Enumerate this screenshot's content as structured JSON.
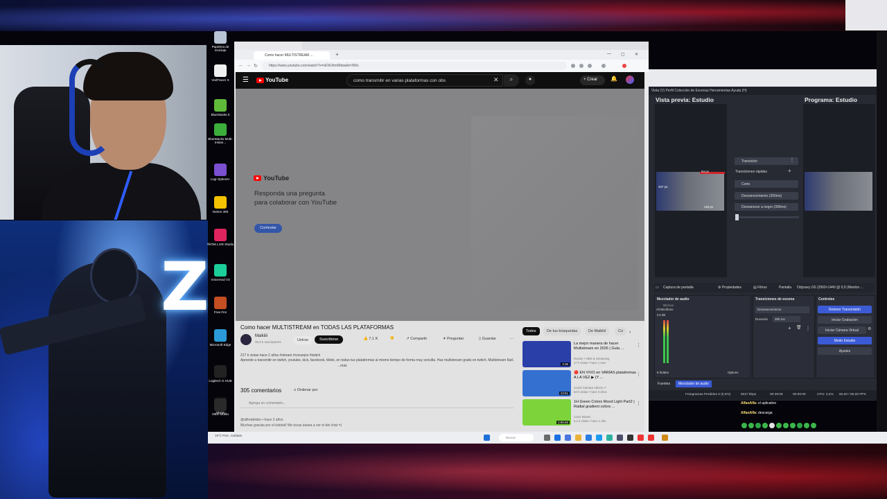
{
  "colors": {
    "youtube_red": "#ff0000",
    "obs_bg": "#272a33",
    "obs_accent": "#3b5bd6",
    "subscribe_bg": "#0f0f0f"
  },
  "desktop_icons": [
    {
      "label": "Papelera de reciclaje",
      "icon": "recycle-bin-icon",
      "color": "#b8c4d4"
    },
    {
      "label": "VodTracer S",
      "icon": "file-icon",
      "color": "#f0f0f0"
    },
    {
      "label": "BlueStacks 5",
      "icon": "bluestacks-icon",
      "color": "#5fba3a"
    },
    {
      "label": "BlueStacks Multi-Instan...",
      "icon": "bluestacks-multi-icon",
      "color": "#3cae3c"
    },
    {
      "label": "Logi Options+",
      "icon": "logi-icon",
      "color": "#7a4fd0"
    },
    {
      "label": "Norton 360",
      "icon": "norton-icon",
      "color": "#f3c200"
    },
    {
      "label": "TikTok LIVE Studio",
      "icon": "tiktok-live-icon",
      "color": "#e0245e"
    },
    {
      "label": "Voicemod V3",
      "icon": "voicemod-icon",
      "color": "#1bcf9a"
    },
    {
      "label": "Free Fire",
      "icon": "freefire-icon",
      "color": "#c24e22"
    },
    {
      "label": "Microsoft Edge",
      "icon": "edge-icon",
      "color": "#2a9bd8"
    },
    {
      "label": "Logitech G HUB",
      "icon": "ghub-icon",
      "color": "#222222"
    },
    {
      "label": "TikTok",
      "icon": "tiktok-icon",
      "color": "#111111"
    },
    {
      "label": "OBS Studio",
      "icon": "obs-icon",
      "color": "#2a2a2a"
    }
  ],
  "browser": {
    "tab_title": "Como hacer MULTISTREAM ...",
    "url": "https://www.youtube.com/watch?v=nEWJhmRbbw&t=350s"
  },
  "youtube": {
    "logo_text": "YouTube",
    "search_query": "como transmitir en varias plataformas con obs",
    "create_label": "Crear",
    "card_logo_text": "YouTube",
    "card_text": "Responda una pregunta para colaborar con YouTube",
    "card_button": "Contestar",
    "video_title": "Como hacer MULTISTREAM en TODAS LAS PLATAFORMAS",
    "channel_name": "Maikiiii",
    "channel_subs": "35,9 k suscriptores",
    "join_label": "Unirse",
    "subscribe_label": "Suscribirse",
    "likes": "7,1 K",
    "share_label": "Compartir",
    "ask_label": "Preguntar",
    "save_label": "Guardar",
    "views_line": "217 k vistas  hace 2 años  #stream #consejos #twitch",
    "description": "Aprende a transmitir en twitch, youtube, kick, facebook, tiktok, en todas tus plataformas al mismo tiempo de forma muy sencilla. Haz multistream gratis en twitch. Multistream fácil.",
    "more_label": "...más",
    "comments_count": "305 comentarios",
    "sort_label": "Ordenar por",
    "add_comment": "Agrega un comentario...",
    "comment_author": "@alfredelobo  •  hace 2 años",
    "comment_text": "Muchas gracias por el tutorial! Me tocas áxiara a ver el del chat =)",
    "chips": [
      "Todos",
      "De tus búsquedas",
      "De Maikiiii",
      "Co"
    ],
    "recommendations": [
      {
        "title": "La mejor manera de hacer Multistream en 2026 | Guía ...",
        "meta": "Rocker • OBS & Streaming\n17 k vistas • hace 1 mes",
        "duration": "3:36",
        "color": "#2a3fa8"
      },
      {
        "title": "🔴 EN VIVO en VARIAS plataformas A LA VEZ ▶ (Y ...",
        "meta": "Lionel Cámara Abierto ✔\n83 k vistas • hace 5 años",
        "duration": "13:51",
        "color": "#3470d0"
      },
      {
        "title": "1H Green Colors Mood Light Part2 | Radial gradient colors ...",
        "meta": "Color Waves\n6,1 k vistas • hace 1 año",
        "duration": "1:00:45",
        "color": "#7cd43a"
      }
    ]
  },
  "obs": {
    "menu": "Vista (V)  Perfil  Colección de Escenas  Herramientas  Ayuda (H)",
    "preview_label": "Vista previa: Estudio",
    "program_label": "Programa: Estudio",
    "transition_label": "Transición",
    "quick_transitions": "Transiciones rápidas",
    "cut_label": "Corte",
    "fade_label": "Desvanecimiento (300ms)",
    "fade_black_label": "Desvanecer a negro (300ms)",
    "source_name": "Captura de pantalla",
    "properties_label": "Propiedades",
    "filters_label": "Filtros",
    "display_label": "Pantalla",
    "display_value": "Odyssey G5 (2560×1440 @ 0,0 (Monitor ...",
    "audio_mixer_title": "Mezclador de audio",
    "audio_device": "Mic/Aux",
    "audio_source": "Alt Micrófono",
    "audio_db": "0.0 dB",
    "hidden_count": "8 hidden",
    "options_label": "Options",
    "scene_transitions_title": "Transiciones de escena",
    "transition_value": "Desvanecimiento",
    "duration_label": "Duración",
    "duration_value": "300 ms",
    "controls_title": "Controles",
    "stop_stream": "Detener Transmisión",
    "start_recording": "Iniciar Grabación",
    "start_virtual_cam": "Iniciar Cámara Virtual",
    "studio_mode": "Modo Estudio",
    "settings": "Ajustes",
    "tab_sources": "Fuentes",
    "tab_mixer": "Mezclador de audio",
    "frames_dropped": "Fotogramas Perdidos 0 (0,0%)",
    "bitrate": "5027 kbps",
    "stream_time": "00:49:06",
    "rec_time": "00:00:00",
    "cpu": "CPU: 3,2%",
    "fps": "60,00 / 60,00 FPS",
    "size_a": "84 px",
    "size_b": "118 px",
    "size_c": "467 px"
  },
  "chat": [
    {
      "user": "AlfaoAlfa:",
      "text": "el aplicativo"
    },
    {
      "user": "AlfaoAlfa:",
      "text": "descarga"
    }
  ],
  "taskbar": {
    "weather": "19°C  Parc. nublado",
    "search_placeholder": "Buscar"
  }
}
